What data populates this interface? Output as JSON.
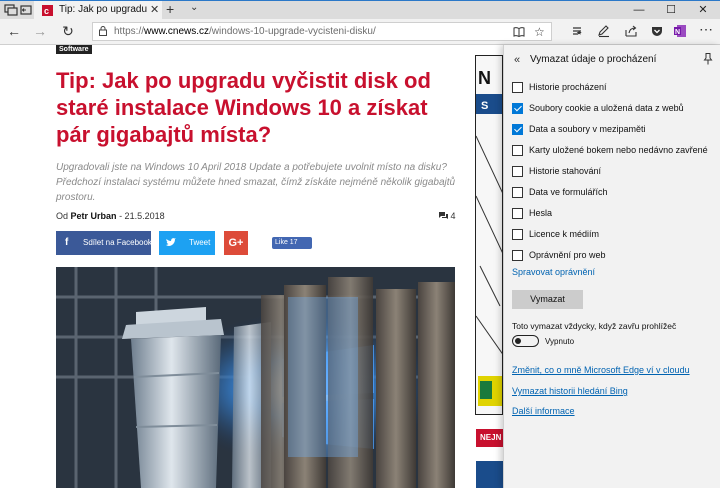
{
  "tab": {
    "title": "Tip: Jak po upgradu vyč",
    "close": "✕",
    "new_tab": "+",
    "tab_list": "⌄"
  },
  "window": {
    "minimize": "—",
    "maximize": "☐",
    "close": "✕"
  },
  "nav": {
    "back": "←",
    "forward": "→",
    "refresh": "↻"
  },
  "address": {
    "prefix": "https://",
    "host": "www.cnews.cz",
    "path": "/windows-10-upgrade-vycisteni-disku/"
  },
  "article": {
    "category": "Software",
    "headline": "Tip: Jak po upgradu vyčistit disk od staré instalace Windows 10 a získat pár gigabajtů místa?",
    "perex": "Upgradovali jste na Windows 10 April 2018 Update a potřebujete uvolnit místo na disku? Předchozí instalaci systému můžete hned smazat, čímž získáte nejméně několik gigabajtů prostoru.",
    "byline_prefix": "Od",
    "author": "Petr Urban",
    "date": "- 21.5.2018",
    "comments": "4",
    "share_facebook": "Sdílet na Facebooku",
    "share_twitter": "Tweet",
    "share_gplus": "G+",
    "like": "Like 17"
  },
  "sidebar": {
    "related_label": "NEJN"
  },
  "panel": {
    "back": "«",
    "title": "Vymazat údaje o procházení",
    "options": [
      {
        "label": "Historie procházení",
        "checked": false
      },
      {
        "label": "Soubory cookie a uložená data z webů",
        "checked": true
      },
      {
        "label": "Data a soubory v mezipaměti",
        "checked": true
      },
      {
        "label": "Karty uložené bokem nebo nedávno zavřené",
        "checked": false
      },
      {
        "label": "Historie stahování",
        "checked": false
      },
      {
        "label": "Data ve formulářích",
        "checked": false
      },
      {
        "label": "Hesla",
        "checked": false
      },
      {
        "label": "Licence k médiím",
        "checked": false
      },
      {
        "label": "Oprávnění pro web",
        "checked": false
      }
    ],
    "manage_permissions": "Spravovat oprávnění",
    "clear_button": "Vymazat",
    "always_clear": "Toto vymazat vždycky, když zavřu prohlížeč",
    "toggle_state": "Vypnuto",
    "toggle_on": false,
    "link_cloud": "Změnit, co o mně Microsoft Edge ví v cloudu",
    "link_bing": "Vymazat historii hledání Bing",
    "link_more": "Další informace"
  },
  "colors": {
    "accent": "#0078d7",
    "headline": "#c8102e",
    "link": "#0063b1",
    "facebook": "#3b5998",
    "twitter": "#1da1f2",
    "gplus": "#dd4b39"
  }
}
